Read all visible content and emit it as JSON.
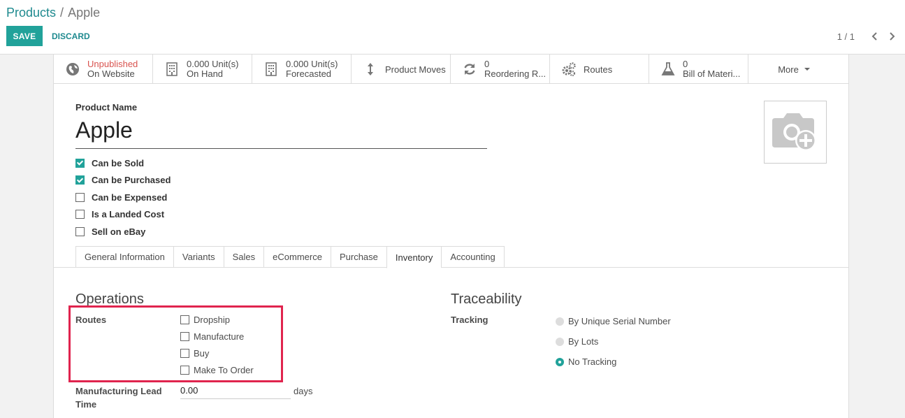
{
  "breadcrumb": {
    "parent": "Products",
    "separator": "/",
    "current": "Apple"
  },
  "toolbar": {
    "save_label": "SAVE",
    "discard_label": "DISCARD"
  },
  "pager": {
    "value": "1 / 1"
  },
  "smart_buttons": {
    "website": {
      "line1": "Unpublished",
      "line2": "On Website",
      "icon": "globe-icon"
    },
    "on_hand": {
      "line1": "0.000 Unit(s)",
      "line2": "On Hand",
      "icon": "building-icon"
    },
    "forecasted": {
      "line1": "0.000 Unit(s)",
      "line2": "Forecasted",
      "icon": "building-icon"
    },
    "product_moves": {
      "label": "Product Moves",
      "icon": "arrows-vertical-icon"
    },
    "reordering": {
      "line1": "0",
      "line2": "Reordering R...",
      "icon": "refresh-icon"
    },
    "routes": {
      "label": "Routes",
      "icon": "gears-icon"
    },
    "bom": {
      "line1": "0",
      "line2": "Bill of Materi...",
      "icon": "flask-icon"
    },
    "more": {
      "label": "More"
    }
  },
  "product": {
    "name_label": "Product Name",
    "name": "Apple",
    "flags": [
      {
        "label": "Can be Sold",
        "checked": true
      },
      {
        "label": "Can be Purchased",
        "checked": true
      },
      {
        "label": "Can be Expensed",
        "checked": false
      },
      {
        "label": "Is a Landed Cost",
        "checked": false
      },
      {
        "label": "Sell on eBay",
        "checked": false
      }
    ]
  },
  "tabs": [
    {
      "label": "General Information",
      "active": false
    },
    {
      "label": "Variants",
      "active": false
    },
    {
      "label": "Sales",
      "active": false
    },
    {
      "label": "eCommerce",
      "active": false
    },
    {
      "label": "Purchase",
      "active": false
    },
    {
      "label": "Inventory",
      "active": true
    },
    {
      "label": "Accounting",
      "active": false
    }
  ],
  "operations": {
    "title": "Operations",
    "routes_label": "Routes",
    "routes": [
      {
        "label": "Dropship",
        "checked": false
      },
      {
        "label": "Manufacture",
        "checked": false
      },
      {
        "label": "Buy",
        "checked": false
      },
      {
        "label": "Make To Order",
        "checked": false
      }
    ],
    "lead_time_label": "Manufacturing Lead Time",
    "lead_time_value": "0.00",
    "lead_time_unit": "days"
  },
  "traceability": {
    "title": "Traceability",
    "tracking_label": "Tracking",
    "options": [
      {
        "label": "By Unique Serial Number",
        "selected": false
      },
      {
        "label": "By Lots",
        "selected": false
      },
      {
        "label": "No Tracking",
        "selected": true
      }
    ]
  },
  "colors": {
    "accent": "#21a29a",
    "link": "#1f8a8f",
    "highlight": "#e0244e",
    "unpublished": "#d9534f"
  }
}
